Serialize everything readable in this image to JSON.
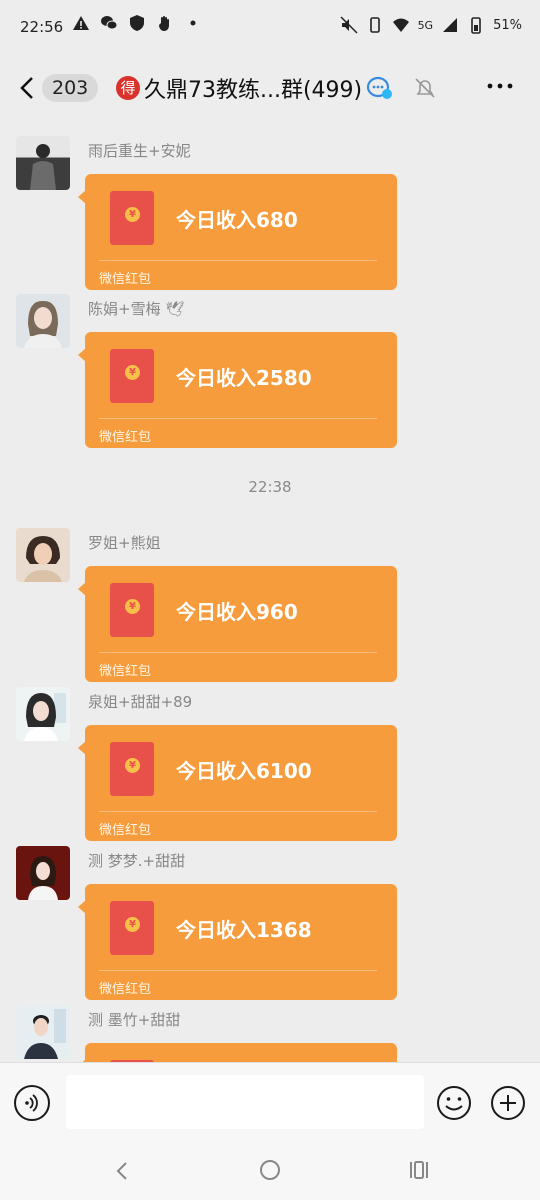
{
  "status_bar": {
    "time": "22:56",
    "network": "5G",
    "battery": "51%"
  },
  "header": {
    "back_count": "203",
    "de_badge": "得",
    "title": "久鼎73教练...群(499)"
  },
  "messages": [
    {
      "sender": "雨后重生+安妮",
      "title": "今日收入680",
      "footer": "微信红包"
    },
    {
      "sender": "陈娟+雪梅 🕊",
      "title": "今日收入2580",
      "footer": "微信红包"
    },
    {
      "sender": "罗姐+熊姐",
      "title": "今日收入960",
      "footer": "微信红包"
    },
    {
      "sender": "泉姐+甜甜+89",
      "title": "今日收入6100",
      "footer": "微信红包"
    },
    {
      "sender": "测  梦梦.+甜甜",
      "title": "今日收入1368",
      "footer": "微信红包"
    },
    {
      "sender": "测 墨竹+甜甜"
    }
  ],
  "timestamp": "22:38",
  "colors": {
    "background": "#ededed",
    "red_packet": "#f79c3c",
    "envelope": "#e8514a"
  }
}
